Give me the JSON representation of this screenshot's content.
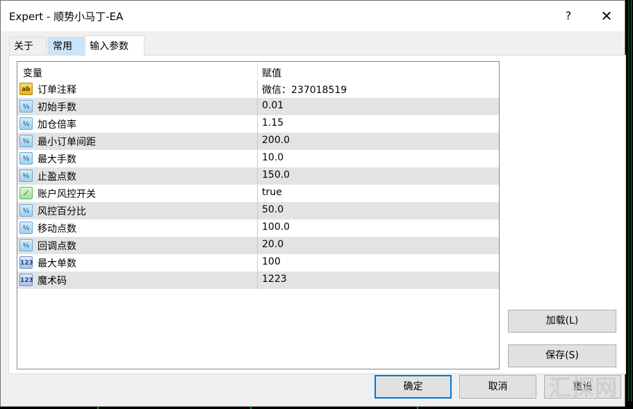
{
  "window": {
    "title": "Expert - 顺势小马丁-EA",
    "help_label": "?",
    "close_label": "✕"
  },
  "tabs": [
    {
      "label": "关于"
    },
    {
      "label": "常用"
    },
    {
      "label": "输入参数",
      "active": true
    }
  ],
  "grid": {
    "headers": {
      "variable": "变量",
      "value": "赋值"
    },
    "rows": [
      {
        "icon": "string-ab-icon",
        "name": "订单注释",
        "value": "微信：237018519"
      },
      {
        "icon": "double-half-icon",
        "name": "初始手数",
        "value": "0.01"
      },
      {
        "icon": "double-half-icon",
        "name": "加仓倍率",
        "value": "1.15"
      },
      {
        "icon": "double-half-icon",
        "name": "最小订单间距",
        "value": "200.0"
      },
      {
        "icon": "double-half-icon",
        "name": "最大手数",
        "value": "10.0"
      },
      {
        "icon": "double-half-icon",
        "name": "止盈点数",
        "value": "150.0"
      },
      {
        "icon": "bool-toggle-icon",
        "name": "账户风控开关",
        "value": "true"
      },
      {
        "icon": "double-half-icon",
        "name": "风控百分比",
        "value": "50.0"
      },
      {
        "icon": "double-half-icon",
        "name": "移动点数",
        "value": "100.0"
      },
      {
        "icon": "double-half-icon",
        "name": "回调点数",
        "value": "20.0"
      },
      {
        "icon": "integer-123-icon",
        "name": "最大单数",
        "value": "100"
      },
      {
        "icon": "integer-123-icon",
        "name": "魔术码",
        "value": "1223"
      }
    ]
  },
  "icons": {
    "string-ab-icon": "ab",
    "double-half-icon": "½",
    "bool-toggle-icon": "⟋",
    "integer-123-icon": "123"
  },
  "buttons": {
    "load": "加载(L)",
    "save": "保存(S)",
    "ok": "确定",
    "cancel": "取消",
    "reset": "重设"
  },
  "watermark": "汇探网"
}
